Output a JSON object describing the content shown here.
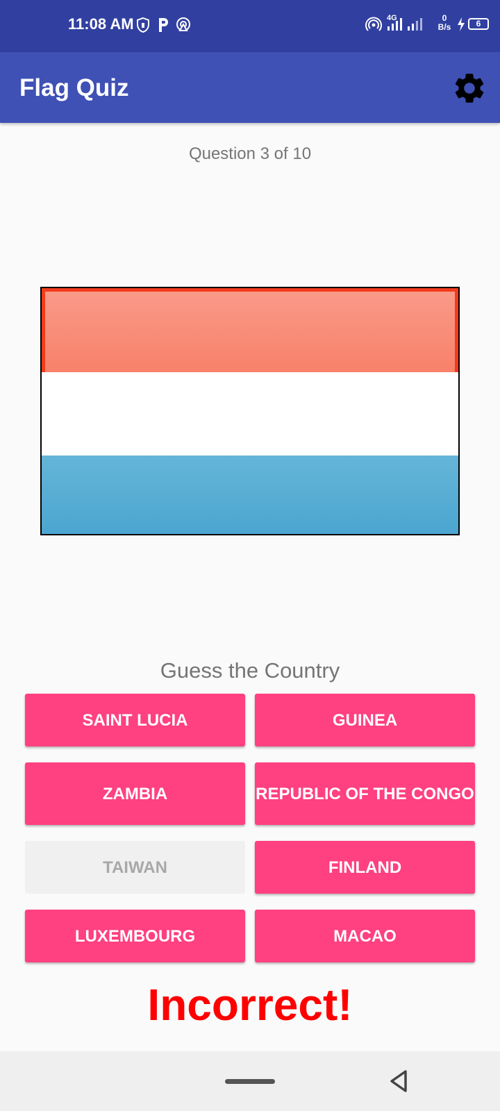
{
  "status_bar": {
    "time": "11:08 AM",
    "network": "4G",
    "speed_value": "0",
    "speed_unit": "B/s",
    "battery": "6"
  },
  "app_bar": {
    "title": "Flag Quiz",
    "settings_icon": "gear-icon"
  },
  "quiz": {
    "question_label": "Question 3 of 10",
    "flag_colors": [
      "#f8816a",
      "#ffffff",
      "#4aa5d0"
    ],
    "prompt": "Guess the Country",
    "answers": [
      {
        "label": "SAINT LUCIA",
        "enabled": true
      },
      {
        "label": "GUINEA",
        "enabled": true
      },
      {
        "label": "ZAMBIA",
        "enabled": true
      },
      {
        "label": "REPUBLIC OF THE CONGO",
        "enabled": true
      },
      {
        "label": "TAIWAN",
        "enabled": false
      },
      {
        "label": "FINLAND",
        "enabled": true
      },
      {
        "label": "LUXEMBOURG",
        "enabled": true
      },
      {
        "label": "MACAO",
        "enabled": true
      }
    ],
    "result": "Incorrect!"
  },
  "colors": {
    "status_bar": "#3140a0",
    "app_bar": "#3f51b5",
    "accent": "#ff4081",
    "result": "#ff0000"
  }
}
